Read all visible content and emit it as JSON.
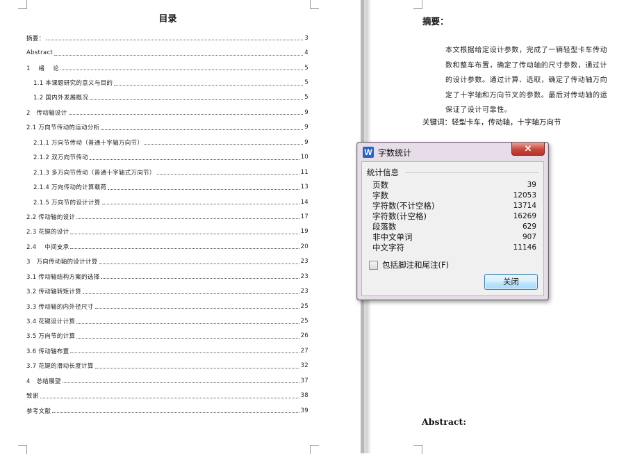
{
  "toc": {
    "title": "目录",
    "items": [
      {
        "label": "摘要：",
        "page": "3",
        "level": 1
      },
      {
        "label": "Abstract",
        "page": "4",
        "level": 1
      },
      {
        "label": "1　 绪　 论",
        "page": "5",
        "level": 1
      },
      {
        "label": "1.1 本课题研究的意义与目的",
        "page": "5",
        "level": 2
      },
      {
        "label": "1.2 国内外发展概况",
        "page": "5",
        "level": 2
      },
      {
        "label": "2　传动轴设计",
        "page": "9",
        "level": 1
      },
      {
        "label": "2.1 万向节传动的运动分析",
        "page": "9",
        "level": 1
      },
      {
        "label": "2.1.1 万向节传动（普通十字轴万向节）",
        "page": "9",
        "level": 2
      },
      {
        "label": "2.1.2 双万向节传动",
        "page": "10",
        "level": 2
      },
      {
        "label": "2.1.3 多万向节传动（普通十字轴式万向节）",
        "page": "11",
        "level": 2
      },
      {
        "label": "2.1.4 万向传动的计算载荷",
        "page": "13",
        "level": 2
      },
      {
        "label": "2.1.5 万向节的设计计算",
        "page": "14",
        "level": 2
      },
      {
        "label": "2.2 传动轴的设计",
        "page": "17",
        "level": 1
      },
      {
        "label": "2.3 花键的设计",
        "page": "19",
        "level": 1
      },
      {
        "label": "2.4　 中间支承",
        "page": "20",
        "level": 1
      },
      {
        "label": "3　万向传动轴的设计计算",
        "page": "23",
        "level": 1
      },
      {
        "label": "3.1 传动轴结构方案的选择",
        "page": "23",
        "level": 1
      },
      {
        "label": "3.2 传动轴转矩计算",
        "page": "23",
        "level": 1
      },
      {
        "label": "3.3 传动轴的内外径尺寸",
        "page": "25",
        "level": 1
      },
      {
        "label": "3.4 花键设计计算",
        "page": "25",
        "level": 1
      },
      {
        "label": "3.5 万向节的计算",
        "page": "26",
        "level": 1
      },
      {
        "label": "3.6 传动轴布置",
        "page": "27",
        "level": 1
      },
      {
        "label": "3.7 花键的滑动长度计算",
        "page": "32",
        "level": 1
      },
      {
        "label": "4　总结展望",
        "page": "37",
        "level": 1
      },
      {
        "label": "致谢",
        "page": "38",
        "level": 1
      },
      {
        "label": "参考文献",
        "page": "39",
        "level": 1
      }
    ]
  },
  "abstract": {
    "heading": "摘要：",
    "lines": [
      "本文根据给定设计参数，完成了一辆轻型卡车传动",
      "数和整车布置，确定了传动轴的尺寸参数，通过计",
      "的设计参数。通过计算、选取，确定了传动轴万向",
      "定了十字轴和万向节叉的参数。最后对传动轴的运",
      "保证了设计可靠性。"
    ],
    "keywords": "关键词：轻型卡车，传动轴，十字轴万向节",
    "english_heading": "Abstract:"
  },
  "dialog": {
    "title": "字数统计",
    "app_icon": "W",
    "close_glyph": "✕",
    "group_label": "统计信息",
    "stats": [
      {
        "label": "页数",
        "value": "39"
      },
      {
        "label": "字数",
        "value": "12053"
      },
      {
        "label": "字符数(不计空格)",
        "value": "13714"
      },
      {
        "label": "字符数(计空格)",
        "value": "16269"
      },
      {
        "label": "段落数",
        "value": "629"
      },
      {
        "label": "非中文单词",
        "value": "907"
      },
      {
        "label": "中文字符",
        "value": "11146"
      }
    ],
    "checkbox_label": "包括脚注和尾注(F)",
    "checkbox_checked": false,
    "close_button": "关闭"
  },
  "colors": {
    "dialog_frame": "#e7dde9",
    "close_red": "#c9463b",
    "button_blue": "#bee6fd",
    "gutter": "#d8d8d8"
  }
}
